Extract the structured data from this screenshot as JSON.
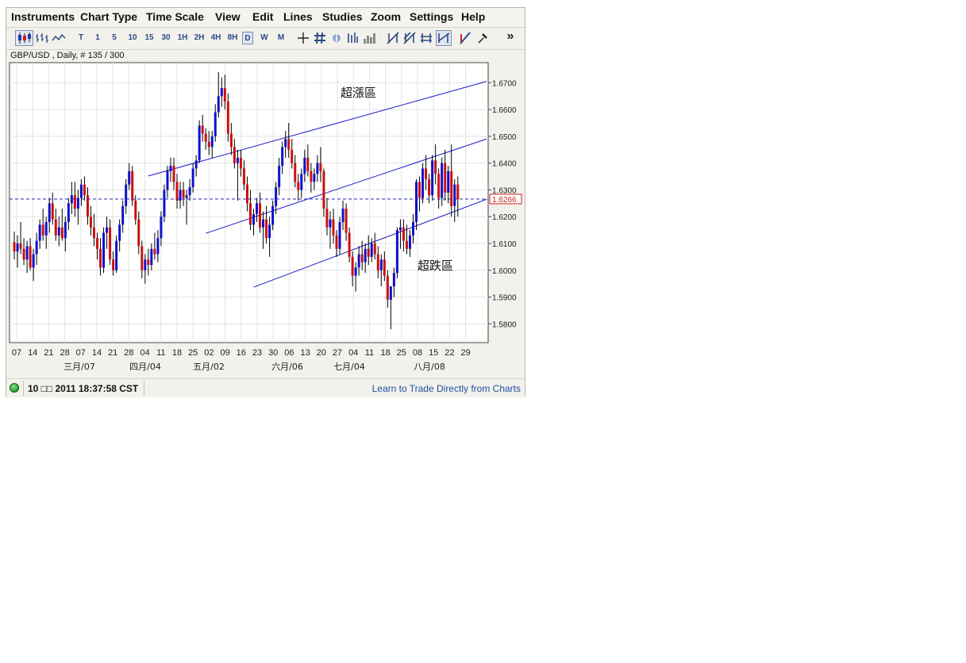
{
  "menu": [
    "Instruments",
    "Chart Type",
    "Time Scale",
    "View",
    "Edit",
    "Lines",
    "Studies",
    "Zoom",
    "Settings",
    "Help"
  ],
  "toolbar": {
    "chart_type_icons": [
      "candlestick-chart-icon",
      "bar-chart-icon",
      "line-chart-icon"
    ],
    "timeframes": [
      "T",
      "1",
      "5",
      "10",
      "15",
      "30",
      "1H",
      "2H",
      "4H",
      "8H",
      "D",
      "W",
      "M"
    ],
    "selected_timeframe": "D",
    "tool_icons": [
      "crosshair-icon",
      "grid-icon",
      "info-icon",
      "data-bars-icon",
      "volume-icon",
      "draw-line-1-icon",
      "draw-line-2-icon",
      "draw-line-3-icon",
      "draw-line-4-icon",
      "fib-tool-icon",
      "pin-icon"
    ],
    "more_label": "»"
  },
  "chart_info": "GBP/USD , Daily, # 135 / 300",
  "status": {
    "time": "10 □□ 2011 18:37:58 CST",
    "link": "Learn to Trade Directly from Charts",
    "indicator_color": "#1aa02a"
  },
  "chart_data": {
    "type": "candlestick",
    "symbol": "GBP/USD",
    "timeframe": "Daily",
    "y_ticks": [
      "1.6700",
      "1.6600",
      "1.6500",
      "1.6400",
      "1.6300",
      "1.6200",
      "1.6100",
      "1.6000",
      "1.5900",
      "1.5800"
    ],
    "ylim": [
      1.573,
      1.6775
    ],
    "current_price": "1.6266",
    "x_day_labels": [
      "07",
      "14",
      "21",
      "28",
      "07",
      "14",
      "21",
      "28",
      "04",
      "11",
      "18",
      "25",
      "02",
      "09",
      "16",
      "23",
      "30",
      "06",
      "13",
      "20",
      "27",
      "04",
      "11",
      "18",
      "25",
      "08",
      "15",
      "22",
      "29"
    ],
    "x_month_labels": [
      "三月/07",
      "四月/04",
      "五月/02",
      "六月/06",
      "七月/04",
      "八月/08"
    ],
    "annotations": [
      "超漲區",
      "超跌區"
    ],
    "colors": {
      "up": "#1010cc",
      "down": "#cc1010",
      "wick": "#000000",
      "channel": "#1a1acc",
      "price_line": "#2a2ab0"
    },
    "channel_lines": [
      {
        "start_index": 42,
        "start_price": 1.6352,
        "end_index": 148,
        "end_price": 1.6705
      },
      {
        "start_index": 60,
        "start_price": 1.6138,
        "end_index": 148,
        "end_price": 1.649
      },
      {
        "start_index": 75,
        "start_price": 1.5937,
        "end_index": 148,
        "end_price": 1.6265
      }
    ],
    "candles": [
      [
        1.6105,
        1.6145,
        1.604,
        1.607
      ],
      [
        1.607,
        1.613,
        1.601,
        1.61
      ],
      [
        1.61,
        1.618,
        1.606,
        1.608
      ],
      [
        1.608,
        1.612,
        1.602,
        1.604
      ],
      [
        1.604,
        1.611,
        1.599,
        1.609
      ],
      [
        1.609,
        1.612,
        1.6,
        1.601
      ],
      [
        1.601,
        1.608,
        1.596,
        1.606
      ],
      [
        1.606,
        1.614,
        1.602,
        1.611
      ],
      [
        1.611,
        1.619,
        1.608,
        1.617
      ],
      [
        1.617,
        1.623,
        1.611,
        1.613
      ],
      [
        1.613,
        1.62,
        1.608,
        1.618
      ],
      [
        1.618,
        1.627,
        1.614,
        1.625
      ],
      [
        1.625,
        1.629,
        1.617,
        1.619
      ],
      [
        1.619,
        1.623,
        1.611,
        1.613
      ],
      [
        1.613,
        1.62,
        1.609,
        1.616
      ],
      [
        1.616,
        1.623,
        1.611,
        1.612
      ],
      [
        1.612,
        1.62,
        1.607,
        1.618
      ],
      [
        1.618,
        1.627,
        1.615,
        1.625
      ],
      [
        1.625,
        1.633,
        1.621,
        1.628
      ],
      [
        1.628,
        1.633,
        1.62,
        1.623
      ],
      [
        1.623,
        1.63,
        1.617,
        1.627
      ],
      [
        1.627,
        1.634,
        1.624,
        1.632
      ],
      [
        1.632,
        1.635,
        1.626,
        1.628
      ],
      [
        1.628,
        1.631,
        1.617,
        1.62
      ],
      [
        1.62,
        1.624,
        1.613,
        1.616
      ],
      [
        1.616,
        1.621,
        1.609,
        1.612
      ],
      [
        1.612,
        1.614,
        1.604,
        1.608
      ],
      [
        1.608,
        1.612,
        1.598,
        1.601
      ],
      [
        1.601,
        1.616,
        1.599,
        1.614
      ],
      [
        1.614,
        1.62,
        1.608,
        1.616
      ],
      [
        1.616,
        1.619,
        1.602,
        1.604
      ],
      [
        1.604,
        1.607,
        1.598,
        1.6
      ],
      [
        1.6,
        1.613,
        1.599,
        1.611
      ],
      [
        1.611,
        1.619,
        1.607,
        1.617
      ],
      [
        1.617,
        1.626,
        1.614,
        1.624
      ],
      [
        1.624,
        1.634,
        1.621,
        1.632
      ],
      [
        1.632,
        1.64,
        1.63,
        1.637
      ],
      [
        1.637,
        1.639,
        1.624,
        1.626
      ],
      [
        1.626,
        1.628,
        1.617,
        1.619
      ],
      [
        1.619,
        1.622,
        1.606,
        1.609
      ],
      [
        1.609,
        1.611,
        1.597,
        1.6
      ],
      [
        1.6,
        1.606,
        1.595,
        1.604
      ],
      [
        1.604,
        1.608,
        1.598,
        1.602
      ],
      [
        1.602,
        1.61,
        1.6,
        1.608
      ],
      [
        1.608,
        1.614,
        1.604,
        1.606
      ],
      [
        1.606,
        1.615,
        1.603,
        1.612
      ],
      [
        1.612,
        1.622,
        1.609,
        1.62
      ],
      [
        1.62,
        1.632,
        1.618,
        1.63
      ],
      [
        1.63,
        1.639,
        1.627,
        1.637
      ],
      [
        1.637,
        1.642,
        1.633,
        1.639
      ],
      [
        1.639,
        1.642,
        1.63,
        1.633
      ],
      [
        1.633,
        1.636,
        1.623,
        1.626
      ],
      [
        1.626,
        1.633,
        1.623,
        1.63
      ],
      [
        1.63,
        1.633,
        1.624,
        1.627
      ],
      [
        1.627,
        1.63,
        1.617,
        1.628
      ],
      [
        1.628,
        1.634,
        1.626,
        1.631
      ],
      [
        1.631,
        1.64,
        1.629,
        1.638
      ],
      [
        1.638,
        1.643,
        1.635,
        1.641
      ],
      [
        1.641,
        1.656,
        1.64,
        1.654
      ],
      [
        1.654,
        1.658,
        1.648,
        1.651
      ],
      [
        1.651,
        1.653,
        1.645,
        1.648
      ],
      [
        1.648,
        1.652,
        1.643,
        1.646
      ],
      [
        1.646,
        1.652,
        1.642,
        1.65
      ],
      [
        1.65,
        1.662,
        1.648,
        1.659
      ],
      [
        1.659,
        1.674,
        1.657,
        1.665
      ],
      [
        1.665,
        1.672,
        1.661,
        1.668
      ],
      [
        1.668,
        1.673,
        1.66,
        1.663
      ],
      [
        1.663,
        1.666,
        1.648,
        1.651
      ],
      [
        1.651,
        1.655,
        1.643,
        1.646
      ],
      [
        1.646,
        1.649,
        1.638,
        1.64
      ],
      [
        1.64,
        1.645,
        1.626,
        1.642
      ],
      [
        1.642,
        1.645,
        1.635,
        1.638
      ],
      [
        1.638,
        1.641,
        1.63,
        1.632
      ],
      [
        1.632,
        1.635,
        1.622,
        1.625
      ],
      [
        1.625,
        1.63,
        1.615,
        1.617
      ],
      [
        1.617,
        1.623,
        1.613,
        1.621
      ],
      [
        1.621,
        1.627,
        1.618,
        1.625
      ],
      [
        1.625,
        1.629,
        1.614,
        1.616
      ],
      [
        1.616,
        1.622,
        1.608,
        1.619
      ],
      [
        1.619,
        1.624,
        1.61,
        1.612
      ],
      [
        1.612,
        1.62,
        1.605,
        1.617
      ],
      [
        1.617,
        1.626,
        1.615,
        1.624
      ],
      [
        1.624,
        1.633,
        1.621,
        1.631
      ],
      [
        1.631,
        1.642,
        1.628,
        1.639
      ],
      [
        1.639,
        1.648,
        1.636,
        1.646
      ],
      [
        1.646,
        1.652,
        1.642,
        1.649
      ],
      [
        1.649,
        1.655,
        1.642,
        1.645
      ],
      [
        1.645,
        1.649,
        1.638,
        1.64
      ],
      [
        1.64,
        1.643,
        1.631,
        1.633
      ],
      [
        1.633,
        1.636,
        1.626,
        1.63
      ],
      [
        1.63,
        1.638,
        1.627,
        1.636
      ],
      [
        1.636,
        1.645,
        1.633,
        1.642
      ],
      [
        1.642,
        1.647,
        1.635,
        1.637
      ],
      [
        1.637,
        1.64,
        1.629,
        1.633
      ],
      [
        1.633,
        1.638,
        1.63,
        1.636
      ],
      [
        1.636,
        1.643,
        1.633,
        1.64
      ],
      [
        1.64,
        1.646,
        1.633,
        1.637
      ],
      [
        1.637,
        1.638,
        1.62,
        1.623
      ],
      [
        1.623,
        1.627,
        1.613,
        1.616
      ],
      [
        1.616,
        1.622,
        1.608,
        1.619
      ],
      [
        1.619,
        1.623,
        1.61,
        1.613
      ],
      [
        1.613,
        1.615,
        1.605,
        1.608
      ],
      [
        1.608,
        1.62,
        1.606,
        1.618
      ],
      [
        1.618,
        1.626,
        1.615,
        1.623
      ],
      [
        1.623,
        1.625,
        1.611,
        1.614
      ],
      [
        1.614,
        1.616,
        1.603,
        1.605
      ],
      [
        1.605,
        1.607,
        1.594,
        1.598
      ],
      [
        1.598,
        1.603,
        1.592,
        1.601
      ],
      [
        1.601,
        1.609,
        1.598,
        1.606
      ],
      [
        1.606,
        1.611,
        1.6,
        1.603
      ],
      [
        1.603,
        1.61,
        1.599,
        1.608
      ],
      [
        1.608,
        1.613,
        1.602,
        1.605
      ],
      [
        1.605,
        1.612,
        1.603,
        1.61
      ],
      [
        1.61,
        1.614,
        1.604,
        1.606
      ],
      [
        1.606,
        1.609,
        1.597,
        1.6
      ],
      [
        1.6,
        1.606,
        1.594,
        1.604
      ],
      [
        1.604,
        1.607,
        1.596,
        1.598
      ],
      [
        1.598,
        1.6,
        1.586,
        1.589
      ],
      [
        1.589,
        1.592,
        1.578,
        1.594
      ],
      [
        1.594,
        1.601,
        1.59,
        1.599
      ],
      [
        1.599,
        1.616,
        1.597,
        1.615
      ],
      [
        1.615,
        1.619,
        1.608,
        1.616
      ],
      [
        1.616,
        1.619,
        1.607,
        1.611
      ],
      [
        1.611,
        1.617,
        1.606,
        1.608
      ],
      [
        1.608,
        1.615,
        1.605,
        1.613
      ],
      [
        1.613,
        1.621,
        1.61,
        1.618
      ],
      [
        1.618,
        1.634,
        1.615,
        1.633
      ],
      [
        1.633,
        1.635,
        1.622,
        1.627
      ],
      [
        1.627,
        1.64,
        1.625,
        1.638
      ],
      [
        1.638,
        1.643,
        1.63,
        1.634
      ],
      [
        1.634,
        1.636,
        1.625,
        1.628
      ],
      [
        1.628,
        1.643,
        1.626,
        1.641
      ],
      [
        1.641,
        1.647,
        1.632,
        1.636
      ],
      [
        1.636,
        1.638,
        1.623,
        1.627
      ],
      [
        1.627,
        1.642,
        1.624,
        1.64
      ],
      [
        1.64,
        1.645,
        1.626,
        1.629
      ],
      [
        1.629,
        1.639,
        1.625,
        1.637
      ],
      [
        1.637,
        1.647,
        1.62,
        1.624
      ],
      [
        1.624,
        1.634,
        1.618,
        1.632
      ],
      [
        1.632,
        1.635,
        1.62,
        1.6266
      ]
    ]
  }
}
